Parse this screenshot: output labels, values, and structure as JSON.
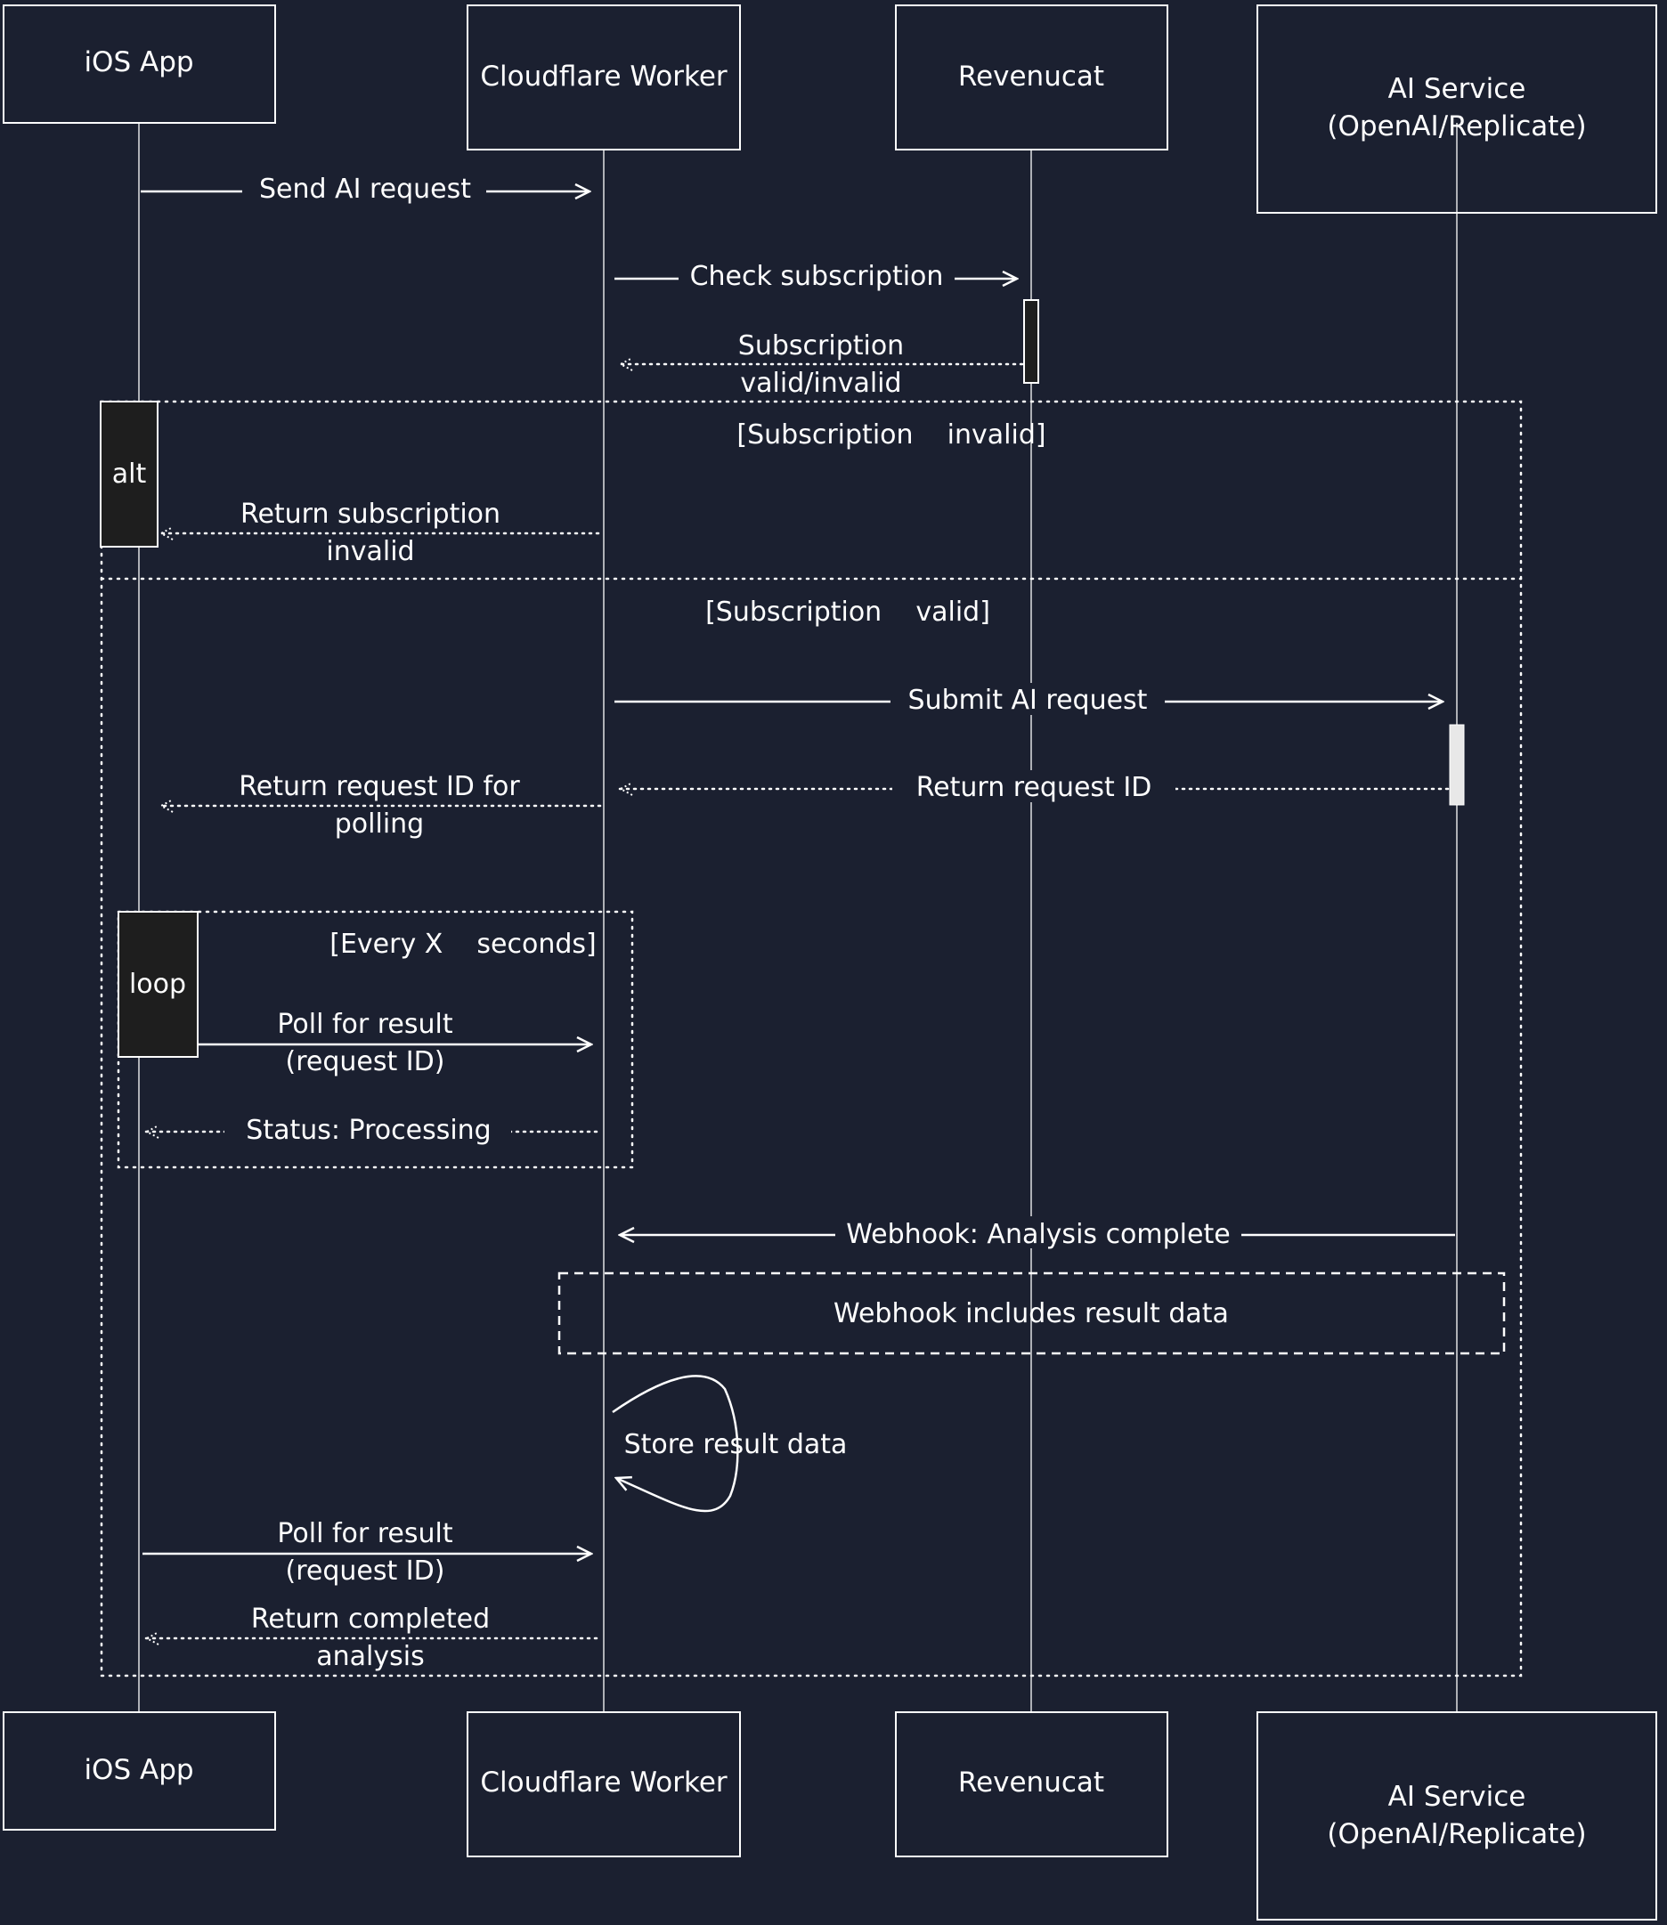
{
  "diagram": {
    "type": "sequence",
    "colors": {
      "background": "#1b2030",
      "stroke": "#ffffff",
      "fragment_tag_fill": "#1e1e1e",
      "activation_dark": "#1e1e1e",
      "activation_light": "#e8e8e8"
    },
    "participants": [
      {
        "id": "ios",
        "label": [
          "iOS App"
        ]
      },
      {
        "id": "cf",
        "label": [
          "Cloudflare Worker"
        ]
      },
      {
        "id": "rc",
        "label": [
          "Revenucat"
        ]
      },
      {
        "id": "ai",
        "label": [
          "AI Service",
          "(OpenAI/Replicate)"
        ]
      }
    ],
    "messages": [
      {
        "from": "ios",
        "to": "cf",
        "style": "solid",
        "label": [
          "Send AI request"
        ]
      },
      {
        "from": "cf",
        "to": "rc",
        "style": "solid",
        "label": [
          "Check subscription"
        ]
      },
      {
        "from": "rc",
        "to": "cf",
        "style": "dotted",
        "label": [
          "Subscription",
          "valid/invalid"
        ]
      },
      {
        "from": "cf",
        "to": "ios",
        "style": "dotted",
        "label": [
          "Return subscription",
          "invalid"
        ]
      },
      {
        "from": "cf",
        "to": "ai",
        "style": "solid",
        "label": [
          "Submit AI request"
        ]
      },
      {
        "from": "ai",
        "to": "cf",
        "style": "dotted",
        "label": [
          "Return request ID"
        ]
      },
      {
        "from": "cf",
        "to": "ios",
        "style": "dotted",
        "label": [
          "Return request ID for",
          "polling"
        ]
      },
      {
        "from": "ios",
        "to": "cf",
        "style": "solid",
        "label": [
          "Poll for result",
          "(request ID)"
        ]
      },
      {
        "from": "cf",
        "to": "ios",
        "style": "dotted",
        "label": [
          "Status: Processing"
        ]
      },
      {
        "from": "ai",
        "to": "cf",
        "style": "solid",
        "label": [
          "Webhook: Analysis complete"
        ]
      },
      {
        "from": "cf",
        "to": "cf",
        "style": "solid",
        "label": [
          "Store result data"
        ]
      },
      {
        "from": "ios",
        "to": "cf",
        "style": "solid",
        "label": [
          "Poll for result",
          "(request ID)"
        ]
      },
      {
        "from": "cf",
        "to": "ios",
        "style": "dotted",
        "label": [
          "Return completed",
          "analysis"
        ]
      }
    ],
    "fragments": [
      {
        "kind": "alt",
        "tag": "alt",
        "conditions": [
          "[Subscription    invalid]",
          "[Subscription    valid]"
        ]
      },
      {
        "kind": "loop",
        "tag": "loop",
        "conditions": [
          "[Every X    seconds]"
        ]
      }
    ],
    "notes": [
      {
        "over": [
          "cf",
          "ai"
        ],
        "text": "Webhook includes result data"
      }
    ]
  }
}
